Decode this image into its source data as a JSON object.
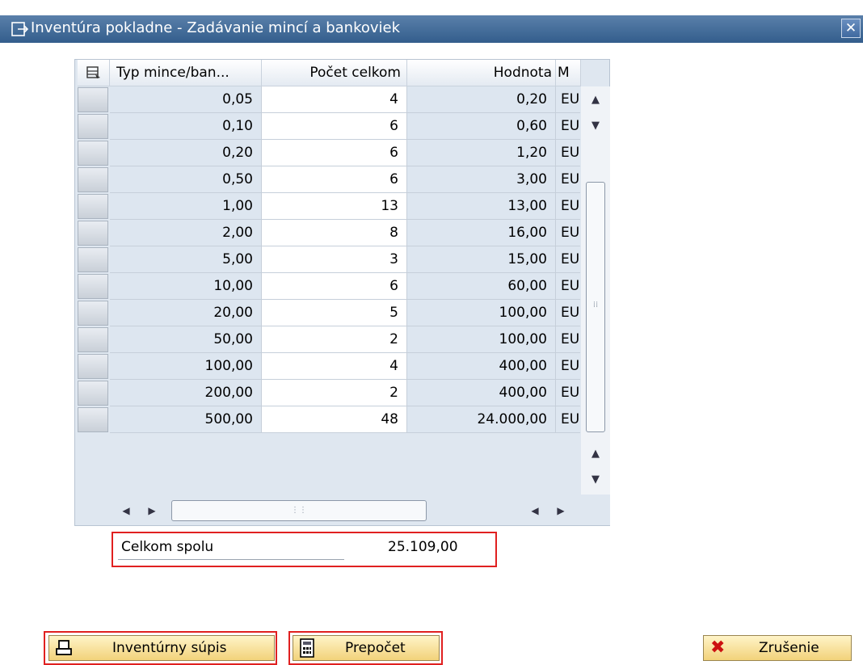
{
  "window": {
    "title": "Inventúra pokladne - Zadávanie mincí a bankoviek",
    "close_icon": "close-icon"
  },
  "table": {
    "columns": [
      "Typ mince/ban...",
      "Počet celkom",
      "Hodnota",
      "M"
    ],
    "rows": [
      {
        "type": "0,05",
        "count": "4",
        "value": "0,20",
        "currency": "EUR"
      },
      {
        "type": "0,10",
        "count": "6",
        "value": "0,60",
        "currency": "EUR"
      },
      {
        "type": "0,20",
        "count": "6",
        "value": "1,20",
        "currency": "EUR"
      },
      {
        "type": "0,50",
        "count": "6",
        "value": "3,00",
        "currency": "EUR"
      },
      {
        "type": "1,00",
        "count": "13",
        "value": "13,00",
        "currency": "EUR"
      },
      {
        "type": "2,00",
        "count": "8",
        "value": "16,00",
        "currency": "EUR"
      },
      {
        "type": "5,00",
        "count": "3",
        "value": "15,00",
        "currency": "EUR"
      },
      {
        "type": "10,00",
        "count": "6",
        "value": "60,00",
        "currency": "EUR"
      },
      {
        "type": "20,00",
        "count": "5",
        "value": "100,00",
        "currency": "EUR"
      },
      {
        "type": "50,00",
        "count": "2",
        "value": "100,00",
        "currency": "EUR"
      },
      {
        "type": "100,00",
        "count": "4",
        "value": "400,00",
        "currency": "EUR"
      },
      {
        "type": "200,00",
        "count": "2",
        "value": "400,00",
        "currency": "EUR"
      },
      {
        "type": "500,00",
        "count": "48",
        "value": "24.000,00",
        "currency": "EUR"
      }
    ]
  },
  "total": {
    "label": "Celkom spolu",
    "value": "25.109,00"
  },
  "buttons": {
    "inventory_list": "Inventúrny súpis",
    "recalculate": "Prepočet",
    "cancel": "Zrušenie"
  },
  "colors": {
    "titlebar": "#3f6a99",
    "highlight": "#e02020",
    "button_fill": "#f2d27a"
  }
}
